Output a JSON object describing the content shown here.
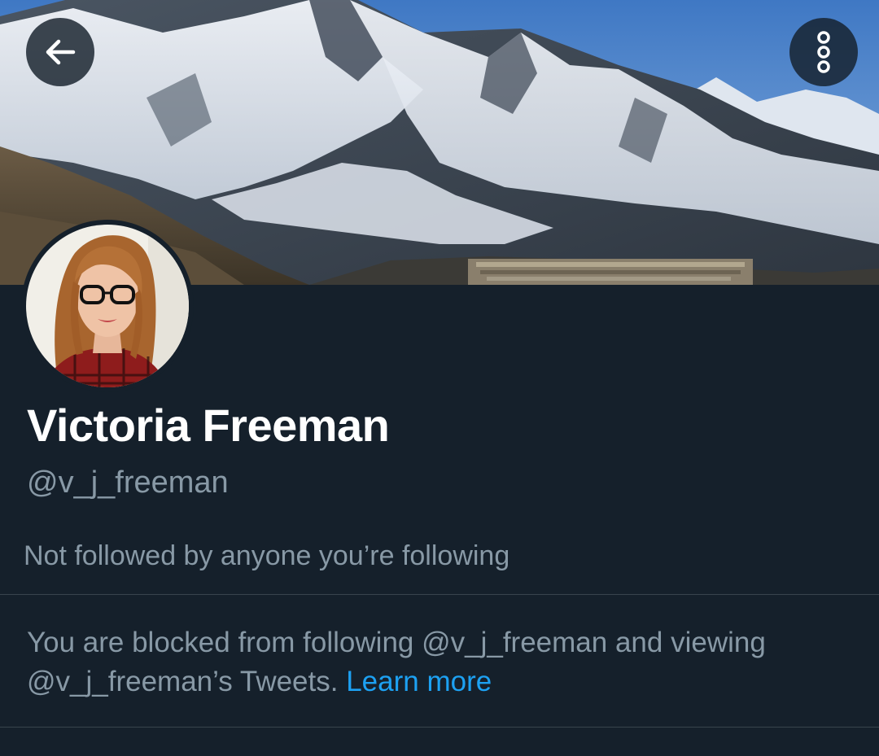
{
  "header": {
    "back_icon": "arrow-left-icon",
    "more_icon": "more-vertical-icon"
  },
  "profile": {
    "name": "Victoria Freeman",
    "handle": "@v_j_freeman",
    "followed_by_text": "Not followed by anyone you’re following"
  },
  "blocked_notice": {
    "text_line1": "You are blocked from following @v_j_freeman and viewing",
    "text_line2": "@v_j_freeman’s Tweets.",
    "link_label": "Learn more"
  },
  "colors": {
    "background": "#15202b",
    "primary_text": "#ffffff",
    "secondary_text": "#8899a6",
    "link": "#1da1f2",
    "divider": "#38444d"
  }
}
